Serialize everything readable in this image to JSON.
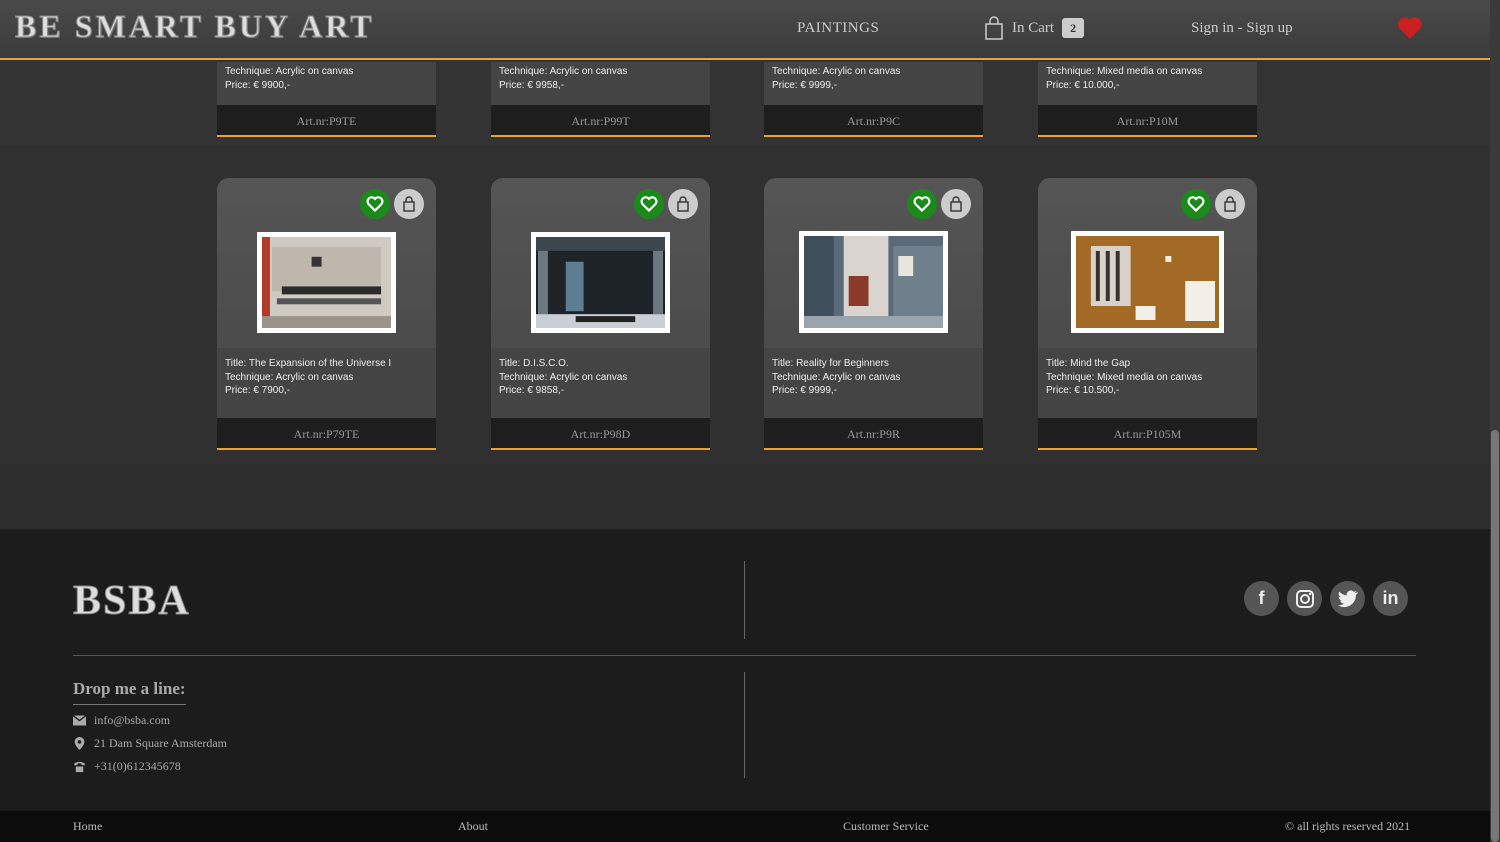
{
  "header": {
    "logo": "BE SMART BUY ART",
    "nav_paintings": "PAINTINGS",
    "cart_label": "In Cart",
    "cart_count": "2",
    "signin": "Sign in - Sign up"
  },
  "top_cards": [
    {
      "technique": "Technique: Acrylic on canvas",
      "price": "Price: € 9900,-",
      "artnr": "Art.nr:P9TE"
    },
    {
      "technique": "Technique: Acrylic on canvas",
      "price": "Price: € 9958,-",
      "artnr": "Art.nr:P99T"
    },
    {
      "technique": "Technique: Acrylic on canvas",
      "price": "Price: € 9999,-",
      "artnr": "Art.nr:P9C"
    },
    {
      "technique": "Technique: Mixed media on canvas",
      "price": "Price: € 10.000,-",
      "artnr": "Art.nr:P10M"
    }
  ],
  "cards": [
    {
      "title": "Title: The Expansion of the Universe I",
      "technique": "Technique: Acrylic on canvas",
      "price": "Price: € 7900,-",
      "artnr": "Art.nr:P79TE"
    },
    {
      "title": "Title: D.I.S.C.O.",
      "technique": "Technique: Acrylic on canvas",
      "price": "Price: € 9858,-",
      "artnr": "Art.nr:P98D"
    },
    {
      "title": "Title: Reality for Beginners",
      "technique": "Technique: Acrylic on canvas",
      "price": "Price: € 9999,-",
      "artnr": "Art.nr:P9R"
    },
    {
      "title": "Title: Mind the Gap",
      "technique": "Technique: Mixed media on canvas",
      "price": "Price: € 10.500,-",
      "artnr": "Art.nr:P105M"
    }
  ],
  "footer": {
    "logo": "BSBA",
    "drop_title": "Drop me a line:",
    "email": "info@bsba.com",
    "address": "21 Dam Square Amsterdam",
    "phone": "+31(0)612345678",
    "socials": [
      "f",
      "in"
    ]
  },
  "bottom": {
    "home": "Home",
    "about": "About",
    "customer_service": "Customer Service",
    "copyright": "© all rights reserved 2021"
  },
  "colors": {
    "accent": "#e8a13a",
    "fav": "#1a8a1a",
    "heart": "#cc1f1f"
  }
}
